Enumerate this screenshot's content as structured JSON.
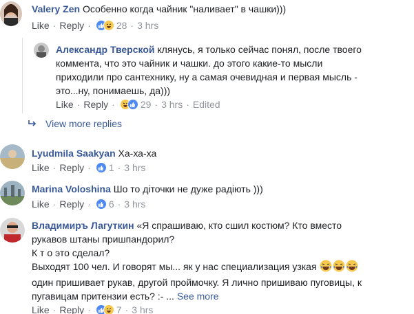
{
  "labels": {
    "like": "Like",
    "reply": "Reply",
    "edited": "Edited"
  },
  "comments": [
    {
      "author": "Valery Zen",
      "text": "Особенно когда чайник \"наливает\" в чашки)))",
      "reactions": [
        "like",
        "haha"
      ],
      "count": "28",
      "time": "3 hrs"
    },
    {
      "author": "Александр Тверской",
      "line1": "клянусь, я только сейчас понял, после твоего",
      "line2": "коммента, что это чайник и чашки. до этого какие-то мысли",
      "line3": "приходили про сантехнику, ну а самая очевидная и первая мысль -",
      "line4": "это...ну, понимаешь, да)))",
      "reactions": [
        "haha",
        "like"
      ],
      "count": "29",
      "time": "3 hrs"
    },
    {
      "author": "Lyudmila Saakyan",
      "text": "Ха-ха-ха",
      "reactions": [
        "like"
      ],
      "count": "1",
      "time": "3 hrs"
    },
    {
      "author": "Marina Voloshina",
      "text": "Шо то діточки не дуже радіють )))",
      "reactions": [
        "like"
      ],
      "count": "6",
      "time": "3 hrs"
    },
    {
      "author": "Владимиръ Лагуткин",
      "line1": "«Я спрашиваю, кто сшил костюм? Кто вместо",
      "line2": "рукавов штаны пришпандорил?",
      "line3": "К т о это сделал?",
      "line4": "Выходят 100 чел. И говорят мы... як у нас специализация узкая",
      "line5": "один пришивает рукав, другой проймочку. Я лично пришиваю пуговицы, к",
      "line6": "пугавицам притензии есть? :- ...",
      "see_more": "See more",
      "reactions": [
        "like",
        "haha"
      ],
      "count": "7",
      "time": "3 hrs"
    }
  ],
  "view_more_replies": "View more replies",
  "icons": {
    "reply_arrow": "reply-arrow-icon",
    "like": "like-reaction-icon",
    "haha": "haha-reaction-icon"
  },
  "colors": {
    "link": "#385898",
    "like_blue": "#4e89f3",
    "haha_yellow": "#f7c84e"
  }
}
